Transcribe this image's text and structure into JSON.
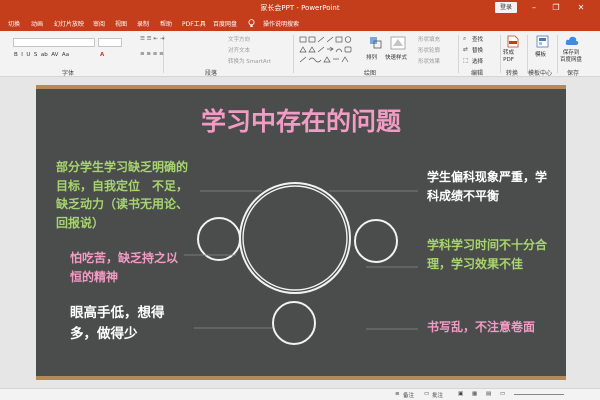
{
  "window": {
    "title": "家长会PPT - PowerPoint",
    "login_label": "登录"
  },
  "menu": {
    "tabs": [
      "切换",
      "动画",
      "幻灯片放映",
      "审阅",
      "视图",
      "录制",
      "帮助",
      "PDF工具",
      "百度网盘"
    ],
    "search_placeholder": "操作说明搜索"
  },
  "ribbon": {
    "groups": {
      "font": "字体",
      "paragraph": "段落",
      "drawing": "绘图",
      "editing": "编辑",
      "convert": "转换",
      "template_center": "模板中心",
      "save": "保存"
    },
    "paragraph": {
      "text_direction": "文字方向",
      "align_text": "对齐文本",
      "smartart": "转换为 SmartArt"
    },
    "drawing": {
      "arrange": "排列",
      "quick_styles": "快速样式",
      "shape_fill": "形状填充",
      "shape_outline": "形状轮廓",
      "shape_effects": "形状效果"
    },
    "editing": {
      "find": "查找",
      "replace": "替换",
      "select": "选择"
    },
    "convert": {
      "to_pdf": "转成\nPDF"
    },
    "template": {
      "template": "模板"
    },
    "save": {
      "save_to_baidu": "保存到\n百度网盘"
    }
  },
  "slide": {
    "title": "学习中存在的问题",
    "left_items": [
      {
        "text": "部分学生学习缺乏明确的目标，自我定位　不足，缺乏动力（读书无用论、回报说）",
        "color": "#a8d46f"
      },
      {
        "text": "怕吃苦，缺乏持之以恒的精神",
        "color": "#f29bc4"
      },
      {
        "text": "眼高手低，想得多，做得少",
        "color": "#ffffff"
      }
    ],
    "right_items": [
      {
        "text": "学生偏科现象严重，学科成绩不平衡",
        "color": "#ffffff"
      },
      {
        "text": "学科学习时间不十分合理，学习效果不佳",
        "color": "#a8d46f"
      },
      {
        "text": "书写乱，不注意卷面",
        "color": "#f29bc4"
      }
    ]
  },
  "status": {
    "notes": "备注",
    "comments": "批注"
  },
  "colors": {
    "accent": "#c43e1c",
    "chalkboard": "#4a4d4c",
    "pink": "#f29bc4",
    "green": "#a8d46f"
  },
  "icons": [
    "lightbulb-icon",
    "minimize-icon",
    "restore-icon",
    "close-icon",
    "find-icon",
    "replace-icon",
    "select-icon",
    "pdf-icon",
    "template-icon",
    "cloud-icon",
    "arrange-icon",
    "quick-styles-icon",
    "notes-icon",
    "comments-icon",
    "normal-view-icon",
    "slide-sorter-icon",
    "reading-view-icon",
    "slideshow-icon"
  ]
}
